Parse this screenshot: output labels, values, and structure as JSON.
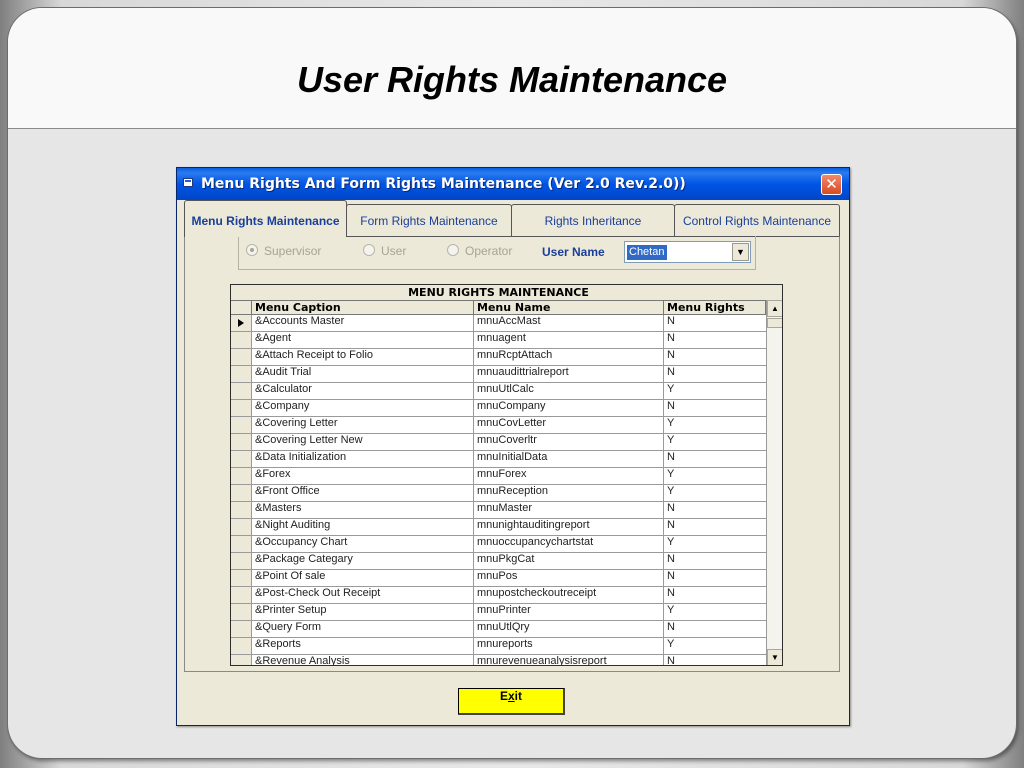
{
  "slide": {
    "title": "User Rights Maintenance"
  },
  "window": {
    "title": "Menu Rights And Form Rights Maintenance (Ver 2.0 Rev.2.0))",
    "close_glyph": "✕"
  },
  "tabs": [
    {
      "label": "Menu Rights Maintenance",
      "active": true
    },
    {
      "label": "Form Rights Maintenance",
      "active": false
    },
    {
      "label": "Rights Inheritance",
      "active": false
    },
    {
      "label": "Control Rights Maintenance",
      "active": false
    }
  ],
  "options": {
    "radios": [
      {
        "label": "Supervisor",
        "checked": true
      },
      {
        "label": "User",
        "checked": false
      },
      {
        "label": "Operator",
        "checked": false
      }
    ],
    "user_name_label": "User Name",
    "user_name_value": "Chetan"
  },
  "grid": {
    "caption": "MENU RIGHTS MAINTENANCE",
    "columns": [
      "Menu Caption",
      "Menu Name",
      "Menu Rights"
    ],
    "rows": [
      {
        "caption": "&Accounts Master",
        "name": "mnuAccMast",
        "rights": "N"
      },
      {
        "caption": "&Agent",
        "name": "mnuagent",
        "rights": "N"
      },
      {
        "caption": "&Attach Receipt to Folio",
        "name": "mnuRcptAttach",
        "rights": "N"
      },
      {
        "caption": "&Audit Trial",
        "name": "mnuaudittrialreport",
        "rights": "N"
      },
      {
        "caption": "&Calculator",
        "name": "mnuUtlCalc",
        "rights": "Y"
      },
      {
        "caption": "&Company",
        "name": "mnuCompany",
        "rights": "N"
      },
      {
        "caption": "&Covering Letter",
        "name": "mnuCovLetter",
        "rights": "Y"
      },
      {
        "caption": "&Covering Letter New",
        "name": "mnuCoverltr",
        "rights": "Y"
      },
      {
        "caption": "&Data Initialization",
        "name": "mnuInitialData",
        "rights": "N"
      },
      {
        "caption": "&Forex",
        "name": "mnuForex",
        "rights": "Y"
      },
      {
        "caption": "&Front Office",
        "name": "mnuReception",
        "rights": "Y"
      },
      {
        "caption": "&Masters",
        "name": "mnuMaster",
        "rights": "N"
      },
      {
        "caption": "&Night Auditing",
        "name": "mnunightauditingreport",
        "rights": "N"
      },
      {
        "caption": "&Occupancy Chart",
        "name": "mnuoccupancychartstat",
        "rights": "Y"
      },
      {
        "caption": "&Package Categary",
        "name": "mnuPkgCat",
        "rights": "N"
      },
      {
        "caption": "&Point Of sale",
        "name": "mnuPos",
        "rights": "N"
      },
      {
        "caption": "&Post-Check Out Receipt",
        "name": "mnupostcheckoutreceipt",
        "rights": "N"
      },
      {
        "caption": "&Printer Setup",
        "name": "mnuPrinter",
        "rights": "Y"
      },
      {
        "caption": "&Query Form",
        "name": "mnuUtlQry",
        "rights": "N"
      },
      {
        "caption": "&Reports",
        "name": "mnureports",
        "rights": "Y"
      },
      {
        "caption": "&Revenue Analysis",
        "name": "mnurevenueanalysisreport",
        "rights": "N"
      }
    ]
  },
  "exit_button": {
    "label_pre": "E",
    "label_ul": "x",
    "label_post": "it"
  }
}
